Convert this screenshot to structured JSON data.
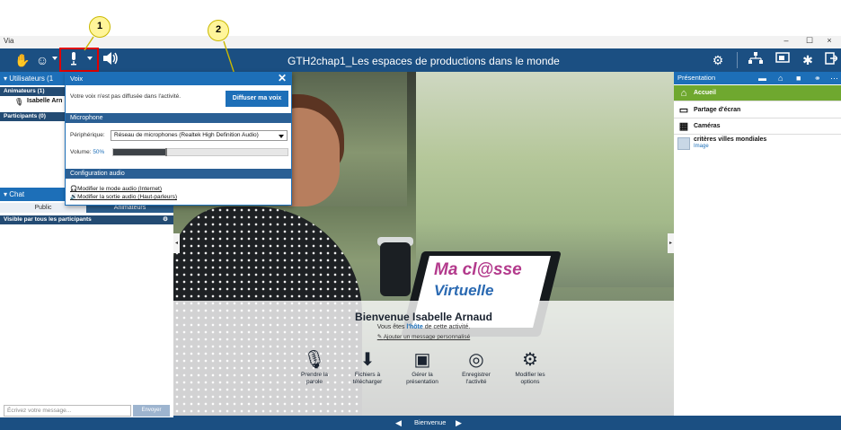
{
  "window": {
    "app_name": "Via",
    "controls": {
      "minimize": "–",
      "maximize": "☐",
      "close": "×"
    }
  },
  "toolbar": {
    "title": "GTH2chap1_Les espaces de productions dans le monde",
    "left_icons": [
      "hand-icon",
      "status-icon",
      "microphone-icon",
      "speaker-icon"
    ],
    "right_icons": [
      "settings-icon",
      "network-icon",
      "presentation-icon",
      "gear-icon",
      "exit-icon"
    ]
  },
  "callouts": {
    "one": "1",
    "two": "2"
  },
  "users_panel": {
    "header": "Utilisateurs (1",
    "animators_label": "Animateurs (1)",
    "user_name": "Isabelle Arn",
    "participants_label": "Participants (0)"
  },
  "chat_panel": {
    "header": "Chat",
    "tab_public": "Public",
    "tab_animators": "Animateurs",
    "visibility": "Visible par tous les participants",
    "input_placeholder": "Écrivez votre message...",
    "send_label": "Envoyer"
  },
  "voice_popup": {
    "title": "Voix",
    "close_label": "✕",
    "status_message": "Votre voix n'est pas diffusée dans l'activité.",
    "broadcast_button": "Diffuser ma voix",
    "microphone_section": "Microphone",
    "device_label": "Périphérique:",
    "device_value": "Réseau de microphones (Realtek High Definition Audio)",
    "volume_label": "Volume:",
    "volume_value": "50%",
    "volume_fraction": 0.5,
    "audio_config_section": "Configuration audio",
    "link_input": "Modifier le mode audio (Internet)",
    "link_output": "Modifier la sortie audio (Haut-parleurs)"
  },
  "stage": {
    "logo_line1": "Ma cl@sse",
    "logo_line2": "Virtuelle",
    "welcome_title": "Bienvenue Isabelle Arnaud",
    "welcome_sub_prefix": "Vous êtes ",
    "welcome_sub_host": "l'hôte",
    "welcome_sub_suffix": " de cette activité.",
    "welcome_link": "Ajouter un message personnalisé",
    "actions": [
      {
        "icon": "microphone-icon",
        "label1": "Prendre la",
        "label2": "parole"
      },
      {
        "icon": "download-icon",
        "label1": "Fichiers à",
        "label2": "télécharger"
      },
      {
        "icon": "presentation-icon",
        "label1": "Gérer la",
        "label2": "présentation"
      },
      {
        "icon": "record-icon",
        "label1": "Enregistrer",
        "label2": "l'activité"
      },
      {
        "icon": "gear-icon",
        "label1": "Modifier les",
        "label2": "options"
      }
    ]
  },
  "presentation_panel": {
    "header": "Présentation",
    "items": [
      {
        "label": "Accueil",
        "icon": "home-icon"
      },
      {
        "label": "Partage d'écran",
        "icon": "monitor-icon"
      },
      {
        "label": "Caméras",
        "icon": "camera-grid-icon"
      }
    ],
    "document_name": "critères villes mondiales",
    "document_type": "Image"
  },
  "bottom_bar": {
    "label": "Bienvenue"
  }
}
